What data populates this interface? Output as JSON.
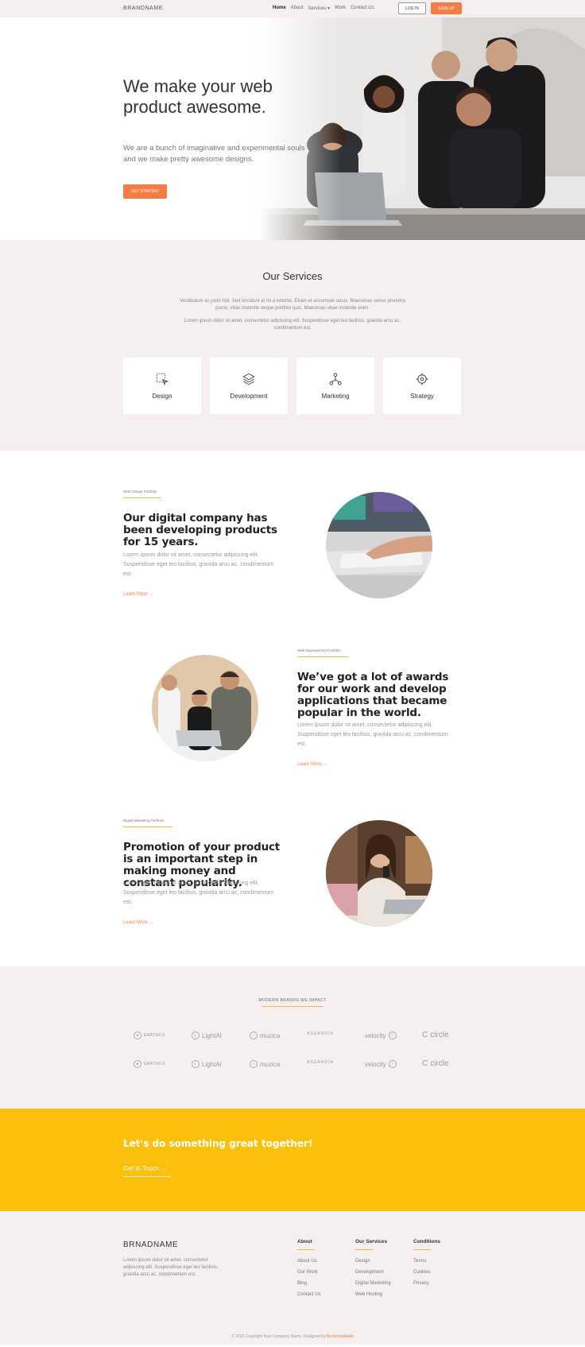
{
  "nav": {
    "brand": "BRANDNAME",
    "items": [
      "Home",
      "About",
      "Services",
      "Work",
      "Contact Us"
    ],
    "login": "LOG IN",
    "signup": "SIGN UP"
  },
  "hero": {
    "title": "We make your web product awesome.",
    "subtitle": "We are a bunch of imaginative and experimental souls and we make pretty awesome designs.",
    "cta": "GET STARTED"
  },
  "services": {
    "title": "Our Services",
    "text1": "Vestibulum ac justo nisl. Sed tincidunt at mi a lobortis. Etiam et accumsan lacus. Maecenas varius pharetra purus, vitae molestie neque porttitor quis. Maecenas vitae molestie enim.",
    "text2": "Lorem ipsum dolor sit amet, consectetur adipiscing elit. Suspendisse eget leo facilisis, gravida arcu ac, condimentum est.",
    "cards": [
      {
        "label": "Design",
        "icon": "select-cursor-icon"
      },
      {
        "label": "Development",
        "icon": "layers-icon"
      },
      {
        "label": "Marketing",
        "icon": "network-icon"
      },
      {
        "label": "Strategy",
        "icon": "target-icon"
      }
    ]
  },
  "portfolio": [
    {
      "tag": "Web Design Portfolio",
      "title": "Our digital company has been developing products for 15 years.",
      "body": "Lorem ipsum dolor sit amet, consectetur adipiscing elit. Suspendisse eget leo facilisis, gravida arcu ac, condimentum est.",
      "link": "Learn More →"
    },
    {
      "tag": "Web Development Portfolio",
      "title": "We’ve got a lot of awards for our work and develop applications that became popular in the world.",
      "body": "Lorem ipsum dolor sit amet, consectetur adipiscing elit. Suspendisse eget leo facilisis, gravida arcu ac, condimentum est.",
      "link": "Learn More →"
    },
    {
      "tag": "Digital Marketing Portfolio",
      "title": "Promotion of your product is an important step in making money and constant popularity.",
      "body": "Lorem ipsum dolor sit amet, consectetur adipiscing elit. Suspendisse eget leo facilisis, gravida arcu ac, condimentum est.",
      "link": "Learn More →"
    }
  ],
  "brands": {
    "heading": "MODERN BRANDS WE IMPACT",
    "logos": [
      "EARTH2.0",
      "LightAI",
      "muzica",
      "ASGARDIA",
      "velocity",
      "circle"
    ]
  },
  "cta": {
    "title": "Let's do something great together!",
    "link": "Get In Touch →"
  },
  "footer": {
    "brand": "BRNADNAME",
    "desc": "Lorem ipsum dolor sit amet, consectetur adipiscing elit. Suspendisse eget leo facilisis, gravida arcu ac, condimentum est.",
    "columns": [
      {
        "title": "About",
        "items": [
          "About Us",
          "Our Work",
          "Blog",
          "Contact Us"
        ]
      },
      {
        "title": "Our Services",
        "items": [
          "Design",
          "Development",
          "Digital Marketing",
          "Web Hosting"
        ]
      },
      {
        "title": "Conditions",
        "items": [
          "Terms",
          "Cookies",
          "Privacy"
        ]
      }
    ],
    "copyright": "© 2020 Copyright Your Company Name. Designed by",
    "designer": "BootstrapMade"
  },
  "colors": {
    "accent": "#f57c45",
    "yellow": "#fbc00c",
    "underline": "#f5b740",
    "light_bg": "#f5f0ef"
  }
}
